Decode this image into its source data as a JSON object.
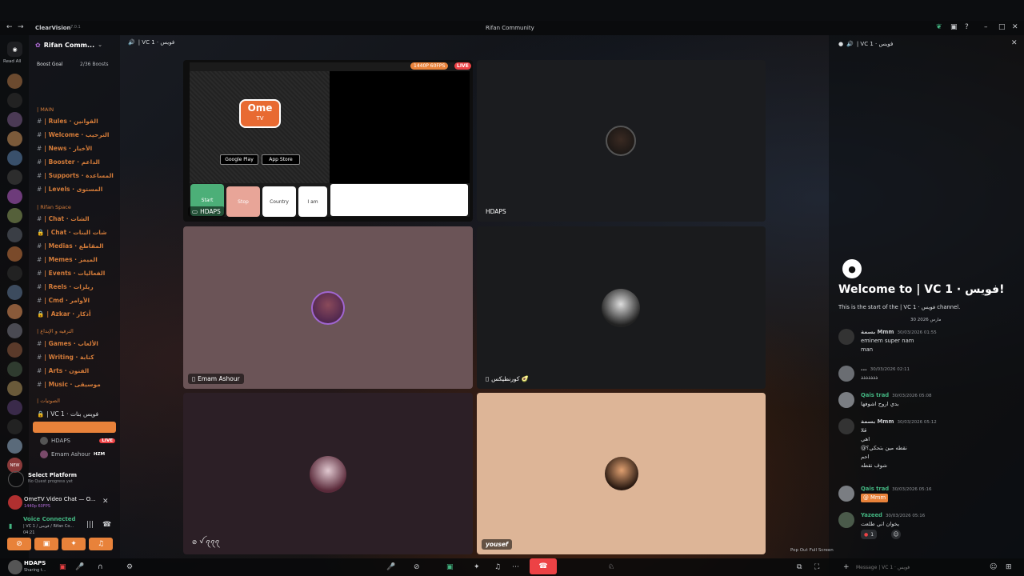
{
  "titlebar": {
    "app_name": "ClearVision",
    "version": "7.0.1",
    "window_title": "Rifan Community"
  },
  "server": {
    "name": "Rifan Comm...",
    "read_all": "Read All",
    "boost_goal": "Boost Goal",
    "boosts": "2/36 Boosts"
  },
  "channel_header": {
    "title": "| VC 1 · فويس"
  },
  "categories": [
    {
      "label": "| MAIN",
      "top": 0
    },
    {
      "label": "| Rifan Space",
      "top": 0
    },
    {
      "label": "| الترفيه و الإبداع",
      "top": 0
    },
    {
      "label": "| الصوتيات",
      "top": 0
    }
  ],
  "channels": [
    {
      "name": "| Rules · القوانين"
    },
    {
      "name": "| Welcome · الترحيب"
    },
    {
      "name": "| News · الأخبار"
    },
    {
      "name": "| Booster · الداعم"
    },
    {
      "name": "| Supports · المساعدة"
    },
    {
      "name": "| Levels · المستوى"
    },
    {
      "name": "| Chat · الشات"
    },
    {
      "name": "| Chat · شات البنات"
    },
    {
      "name": "| Medias · المقاطع"
    },
    {
      "name": "| Memes · الميمز"
    },
    {
      "name": "| Events · الفعاليات"
    },
    {
      "name": "| Reels · ريلزات"
    },
    {
      "name": "| Cmd · الأوامر"
    },
    {
      "name": "| Azkar · أذكار"
    },
    {
      "name": "| Games · الألعاب"
    },
    {
      "name": "| Writing · كتابة"
    },
    {
      "name": "| Arts · الفنون"
    },
    {
      "name": "| Music · موسيقى"
    },
    {
      "name": "| VC 1 · فويس بنات"
    }
  ],
  "voice_users": [
    {
      "name": "HDAPS",
      "badge": "LIVE"
    },
    {
      "name": "Emam Ashour",
      "badge": "HZM"
    }
  ],
  "quest": {
    "title": "Select Platform",
    "subtitle": "No Quest progress yet"
  },
  "activity": {
    "title": "OmeTV Video Chat — O...",
    "quality": "1440p 60FPS"
  },
  "voice": {
    "status": "Voice Connected",
    "channel": "| VC 1 / فويس / Rifan Co...",
    "timer": "04:21"
  },
  "user": {
    "name": "HDAPS",
    "status": "Sharing t..."
  },
  "stage": {
    "tiles": [
      {
        "label": "HDAPS",
        "stream_badge": "1440P 60FPS",
        "live": "LIVE"
      },
      {
        "label": "HDAPS"
      },
      {
        "label": "Emam Ashour"
      },
      {
        "label": "كورنطيكس 🥑"
      },
      {
        "label": "ꪜ ꪖꪖꪖ"
      },
      {
        "label": "yousef"
      }
    ],
    "ometv": {
      "logo": "Ome",
      "logo_sub": "TV",
      "google_play": "Google Play",
      "app_store": "App Store",
      "start": "Start",
      "stop": "Stop",
      "country": "Country",
      "i_am": "I am"
    }
  },
  "chat": {
    "header": "| VC 1 · فويس",
    "welcome_title": "Welcome to | VC 1 · فويس!",
    "welcome_sub": "This is the start of the | VC 1 · فويس channel.",
    "date_divider": "30 مارس 2026",
    "messages": [
      {
        "name": "بسمة Mmm",
        "time": "30/03/2026 01:55",
        "lines": [
          "eminem super nam",
          "man"
        ]
      },
      {
        "name": "...",
        "time": "30/03/2026 02:11",
        "lines": [
          "ذذذذذذذ"
        ]
      },
      {
        "name": "Qais trad",
        "time": "30/03/2026 05:08",
        "lines": [
          "بدي اروح اشوفها"
        ]
      },
      {
        "name": "بسمة Mmm",
        "time": "30/03/2026 05:12",
        "lines": [
          "قلا",
          "اهي",
          "@نقطه مين بتحكي؟",
          "احم",
          "شوف نقطه"
        ]
      },
      {
        "name": "Qais trad",
        "time": "30/03/2026 05:16",
        "lines": [
          "@ Mmm"
        ]
      },
      {
        "name": "Yazeed",
        "time": "30/03/2026 05:16",
        "lines": [
          "يخوان اني طلعت"
        ],
        "reaction_count": "1"
      }
    ],
    "input_placeholder": "Message | VC 1 · فويس",
    "pop_out": "Pop Out",
    "full_screen": "Full Screen"
  },
  "colors": {
    "accent": "#e8823a",
    "green": "#43b581",
    "live": "#ed4245"
  }
}
